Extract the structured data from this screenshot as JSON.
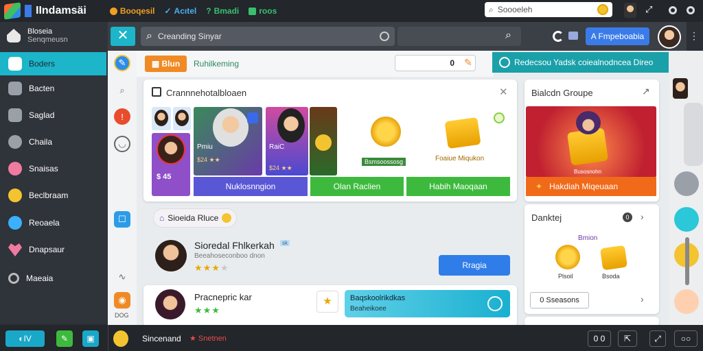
{
  "topbar": {
    "brand": "IIndamsäi",
    "tags": [
      {
        "label": "Booqesil",
        "color": "#f0a020"
      },
      {
        "label": "Acıtel",
        "color": "#4ab0f0"
      },
      {
        "label": "Bmadi",
        "color": "#38c070"
      },
      {
        "label": "roos",
        "color": "#38c070"
      }
    ],
    "search_value": "Soooeleh"
  },
  "sidebar": {
    "header_title": "Bloseia",
    "header_sub": "Senqmeusn",
    "items": [
      {
        "label": "Boders",
        "icon": "chat-icon",
        "color": "#3ab0ff"
      },
      {
        "label": "Bacten",
        "icon": "folder-icon",
        "color": "#888"
      },
      {
        "label": "Saglad",
        "icon": "inbox-icon",
        "color": "#888"
      },
      {
        "label": "Chaila",
        "icon": "gamepad-icon",
        "color": "#888"
      },
      {
        "label": "Snaisas",
        "icon": "face-icon",
        "color": "#f07aa0"
      },
      {
        "label": "Beclbraam",
        "icon": "smile-icon",
        "color": "#f4c430"
      },
      {
        "label": "Reoaela",
        "icon": "people-icon",
        "color": "#3ab0ff"
      },
      {
        "label": "Dnapsaur",
        "icon": "heart-icon",
        "color": "#f07aa0"
      },
      {
        "label": "Maeaia",
        "icon": "search-icon",
        "color": "#aaa"
      }
    ]
  },
  "toolbar": {
    "close_label": "✕",
    "search_value": "Creanding Sinyar",
    "primary_button": "A Fmpeboabia"
  },
  "filter": {
    "pill_label": "Blun",
    "label": "Ruhilkeming",
    "count_value": "0"
  },
  "banner": {
    "text": "Redecsou  Yadsk coiealnodncea  Direo"
  },
  "main_card": {
    "title": "Crannnehotalbloaen",
    "profiles": [
      {
        "caption": "Pmiu",
        "sub": "$24 ★★"
      },
      {
        "caption": "RaiC",
        "sub": "$24 ★★"
      }
    ],
    "tile_price": "$ 45",
    "bars": [
      {
        "label": "Nuklosnngion",
        "color": "#5a57d6"
      },
      {
        "label": "Olan Raclien",
        "color": "#3dba3d"
      },
      {
        "label": "Habih Maoqaan",
        "color": "#3dba3d"
      }
    ],
    "reward1_label": "Bsmsoossosg",
    "reward2_label": "Foaiue Miqukon"
  },
  "tag_chip": "Sioeida Rluce",
  "profile_row": {
    "name": "Sioredal Fhlkerkah",
    "badge": "sk",
    "sub": "Beeahoseconboo dnon",
    "stars": 3,
    "button": "Rragia"
  },
  "bottom_row": {
    "name": "Pracnepric  kar",
    "stars": 3,
    "promo_title": "Baqskoolrikdkas",
    "promo_sub": "Beaheikoee"
  },
  "right_card1": {
    "title": "Bialcdn Groupe",
    "bar": "Hakdiah Miqeuaan",
    "sub": "Busosnohn"
  },
  "right_card2": {
    "title": "Danktej",
    "count": "0",
    "label_top": "Bmion",
    "coin1": "Plsoil",
    "coin2": "Bsoda",
    "seasons": "0 Sseasons"
  },
  "bottombar": {
    "left_btn": "IV",
    "label": "Sincenand",
    "label_red": "★ Snetnen",
    "chip": "0 0"
  },
  "iconcol": {
    "footer": "DOG"
  }
}
